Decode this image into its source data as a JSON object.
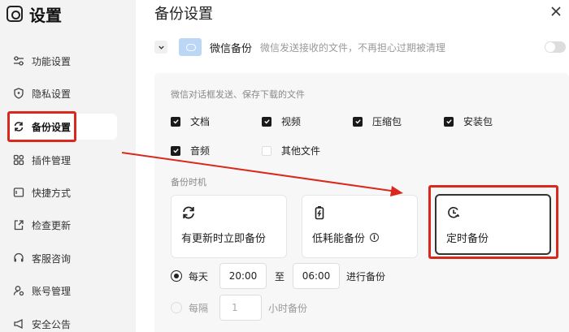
{
  "app": {
    "title": "设置"
  },
  "sidebar": {
    "items": [
      {
        "label": "功能设置",
        "icon": "sliders-icon"
      },
      {
        "label": "隐私设置",
        "icon": "shield-icon"
      },
      {
        "label": "备份设置",
        "icon": "sync-icon",
        "active": true
      },
      {
        "label": "插件管理",
        "icon": "grid-icon"
      },
      {
        "label": "快捷方式",
        "icon": "shortcut-icon"
      },
      {
        "label": "检查更新",
        "icon": "update-icon"
      },
      {
        "label": "客服咨询",
        "icon": "headset-icon"
      },
      {
        "label": "账号管理",
        "icon": "user-settings-icon"
      },
      {
        "label": "安全公告",
        "icon": "megaphone-icon"
      }
    ]
  },
  "main": {
    "title": "备份设置",
    "wechat": {
      "title": "微信备份",
      "description": "微信发送接收的文件，不再担心过期被清理",
      "enabled": false
    },
    "file_types_label": "微信对话框发送、保存下载的文件",
    "file_types": [
      {
        "label": "文档",
        "checked": true
      },
      {
        "label": "视频",
        "checked": true
      },
      {
        "label": "压缩包",
        "checked": true
      },
      {
        "label": "安装包",
        "checked": true
      },
      {
        "label": "音频",
        "checked": true
      },
      {
        "label": "其他文件",
        "checked": false
      }
    ],
    "timing_label": "备份时机",
    "timing_options": [
      {
        "label": "有更新时立即备份",
        "icon": "refresh-icon"
      },
      {
        "label": "低耗能备份",
        "icon": "battery-icon",
        "info": "i"
      },
      {
        "label": "定时备份",
        "icon": "clock-icon",
        "selected": true
      }
    ],
    "schedule": {
      "daily": {
        "label": "每天",
        "from": "20:00",
        "to_label": "至",
        "to": "06:00",
        "suffix": "进行备份",
        "selected": true
      },
      "interval": {
        "label": "每隔",
        "value": "1",
        "suffix": "小时备份",
        "selected": false
      }
    }
  },
  "colors": {
    "highlight": "#d9291c",
    "accent": "#1a1a1a"
  }
}
